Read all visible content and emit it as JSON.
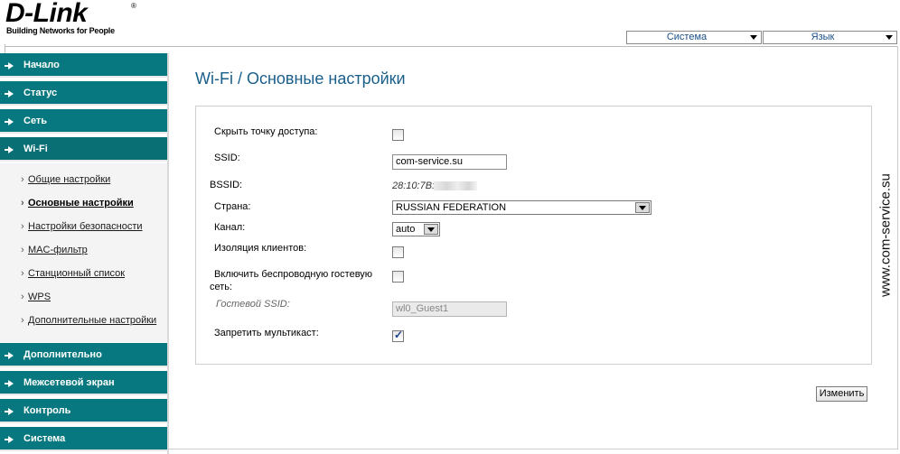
{
  "logo": {
    "brand": "D-Link",
    "registered": "®",
    "tagline": "Building Networks for People"
  },
  "header": {
    "system_select": "Система",
    "language_select": "Язык"
  },
  "sidebar": {
    "items": [
      {
        "label": "Начало"
      },
      {
        "label": "Статус"
      },
      {
        "label": "Сеть"
      },
      {
        "label": "Wi-Fi"
      },
      {
        "label": "Дополнительно"
      },
      {
        "label": "Межсетевой экран"
      },
      {
        "label": "Контроль"
      },
      {
        "label": "Система"
      }
    ],
    "wifi_submenu": [
      {
        "label": "Общие настройки"
      },
      {
        "label": "Основные настройки"
      },
      {
        "label": "Настройки безопасности"
      },
      {
        "label": "MAC-фильтр"
      },
      {
        "label": "Станционный список"
      },
      {
        "label": "WPS"
      },
      {
        "label": "Дополнительные настройки"
      }
    ],
    "active_submenu": "Основные настройки"
  },
  "main": {
    "title": "Wi-Fi /  Основные настройки",
    "form": {
      "hide_ap_label": "Скрыть точку доступа:",
      "hide_ap_checked": false,
      "ssid_label": "SSID:",
      "ssid_value": "com-service.su",
      "bssid_label": "BSSID:",
      "bssid_value": "28:10:7B:",
      "country_label": "Страна:",
      "country_value": "RUSSIAN FEDERATION",
      "channel_label": "Канал:",
      "channel_value": "auto",
      "client_isolation_label": "Изоляция клиентов:",
      "client_isolation_checked": false,
      "guest_net_label_line1": "Включить беспроводную гостевую",
      "guest_net_label_line2": "сеть:",
      "guest_net_checked": false,
      "guest_ssid_label": "Гостевой SSID:",
      "guest_ssid_value": "wl0_Guest1",
      "block_multicast_label": "Запретить мультикаст:",
      "block_multicast_checked": true
    },
    "change_button": "Изменить"
  },
  "watermark": "www.com-service.su"
}
